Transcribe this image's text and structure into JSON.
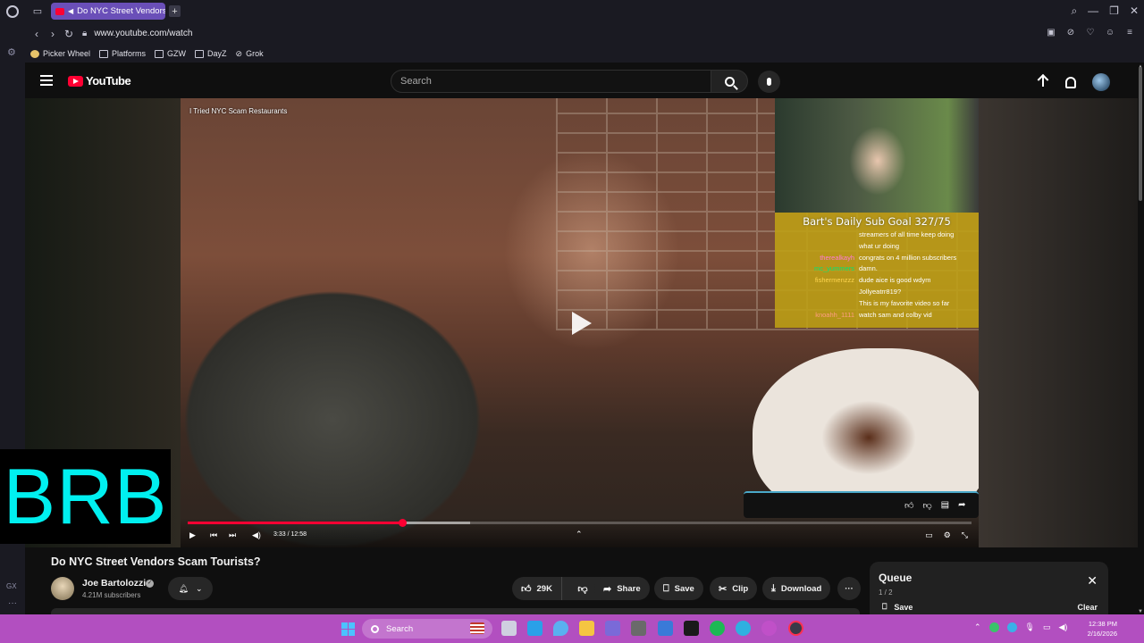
{
  "browser": {
    "tab_title": "Do NYC Street Vendors",
    "url": "www.youtube.com/watch",
    "bookmarks": [
      "Picker Wheel",
      "Platforms",
      "GZW",
      "DayZ",
      "Grok"
    ],
    "sidebar_label": "GX"
  },
  "youtube": {
    "logo_text": "YouTube",
    "search_placeholder": "Search"
  },
  "video": {
    "overlay_title": "I Tried NYC Scam Restaurants",
    "time": "3:33 / 12:58",
    "progress_fraction": 0.274,
    "buffered_fraction": 0.36,
    "title": "Do NYC Street Vendors Scam Tourists?"
  },
  "stream_overlay": {
    "goal": "Bart's Daily Sub Goal 327/75",
    "chat": [
      {
        "user": "",
        "msg": "streamers of all time keep doing",
        "color": "#ffffff"
      },
      {
        "user": "",
        "msg": "what ur doing",
        "color": "#ffffff"
      },
      {
        "user": "therealkayh",
        "msg": "congrats on 4 million subscribers",
        "color": "#ff7ad9"
      },
      {
        "user": "mc_yummers",
        "msg": "damn.",
        "color": "#00e676"
      },
      {
        "user": "fishermenzzz",
        "msg": "dude aice is good wdym",
        "color": "#ffd54f"
      },
      {
        "user": "",
        "msg": "Jollyeatrr819?",
        "color": "#ffffff"
      },
      {
        "user": "",
        "msg": "This is my favorite video so far",
        "color": "#9575cd"
      },
      {
        "user": "knoahh_1111",
        "msg": "watch sam and colby vid",
        "color": "#ff9e80"
      }
    ],
    "brb": "BRB"
  },
  "channel": {
    "name": "Joe Bartolozzi",
    "subscribers": "4.21M subscribers"
  },
  "actions": {
    "likes": "29K",
    "share": "Share",
    "save": "Save",
    "clip": "Clip",
    "download": "Download"
  },
  "queue": {
    "title": "Queue",
    "count": "1 / 2",
    "save": "Save",
    "clear": "Clear"
  },
  "taskbar": {
    "search": "Search",
    "time": "12:38 PM",
    "date": "2/16/2026"
  },
  "colors": {
    "accent_red": "#ff0033",
    "brb_cyan": "#00f0f0",
    "taskbar": "#b24fc0",
    "tab_active": "#6a4fb8"
  }
}
